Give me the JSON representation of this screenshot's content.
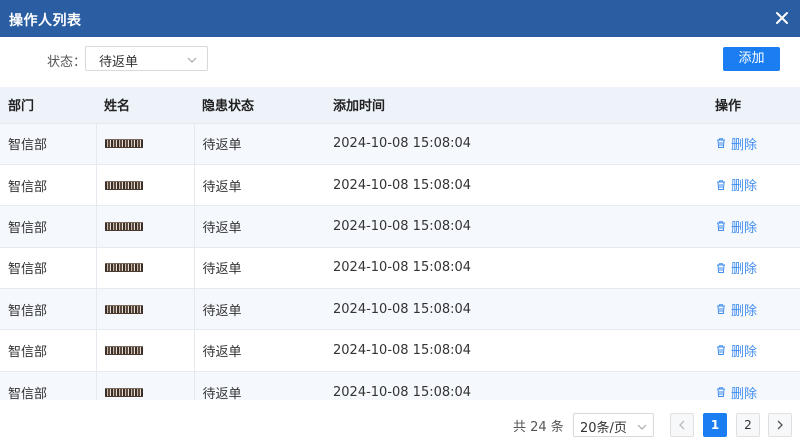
{
  "window": {
    "title": "操作人列表"
  },
  "filter": {
    "label": "状态：",
    "selected": "待返单",
    "add_label": "添加"
  },
  "table": {
    "headers": [
      "部门",
      "姓名",
      "隐患状态",
      "添加时间",
      "操作"
    ],
    "rows": [
      {
        "dept": "智信部",
        "status": "待返单",
        "time": "2024-10-08 15:08:04",
        "action": "删除"
      },
      {
        "dept": "智信部",
        "status": "待返单",
        "time": "2024-10-08 15:08:04",
        "action": "删除"
      },
      {
        "dept": "智信部",
        "status": "待返单",
        "time": "2024-10-08 15:08:04",
        "action": "删除"
      },
      {
        "dept": "智信部",
        "status": "待返单",
        "time": "2024-10-08 15:08:04",
        "action": "删除"
      },
      {
        "dept": "智信部",
        "status": "待返单",
        "time": "2024-10-08 15:08:04",
        "action": "删除"
      },
      {
        "dept": "智信部",
        "status": "待返单",
        "time": "2024-10-08 15:08:04",
        "action": "删除"
      },
      {
        "dept": "智信部",
        "status": "待返单",
        "time": "2024-10-08 15:08:04",
        "action": "删除"
      }
    ]
  },
  "pagination": {
    "total_text": "共 24 条",
    "page_size": "20条/页",
    "pages": [
      "1",
      "2"
    ],
    "current": "1"
  },
  "colors": {
    "header": "#2a5da1",
    "primary": "#1a7ef2",
    "link": "#3f8df0"
  },
  "icons": {
    "close": "close-icon",
    "dropdown": "chevron-down-icon",
    "delete": "trash-icon",
    "prev": "chevron-left-icon",
    "next": "chevron-right-icon"
  }
}
